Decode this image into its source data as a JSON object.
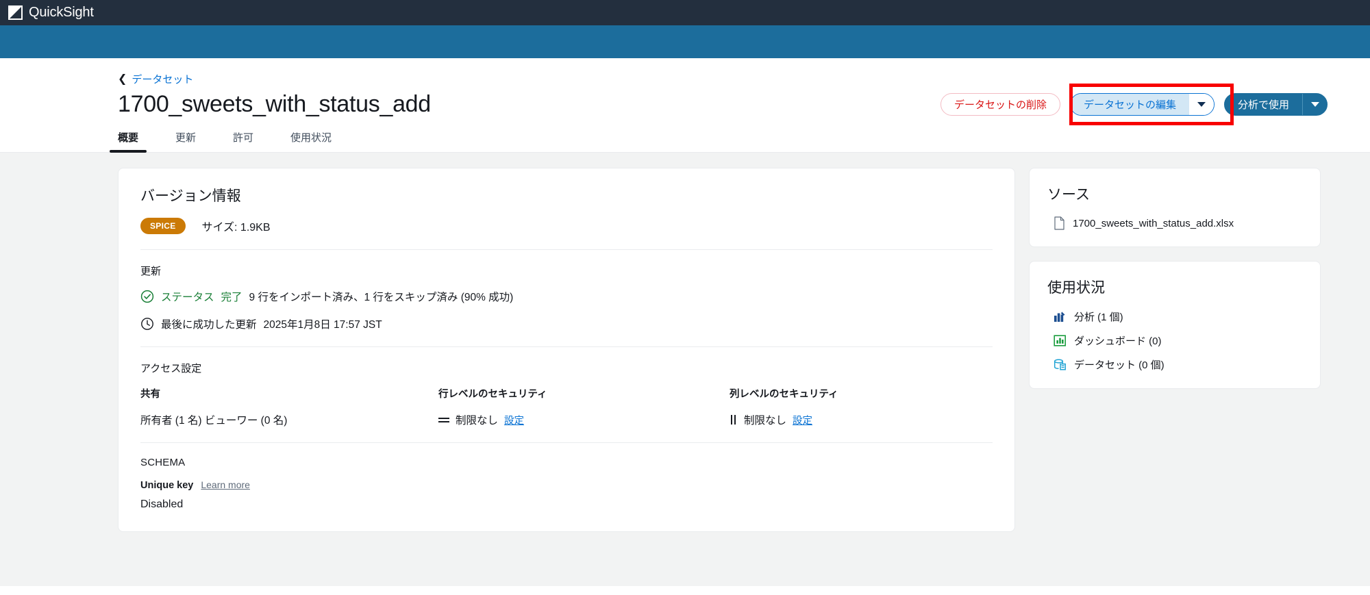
{
  "app": {
    "name": "QuickSight",
    "logo_icon": "quicksight-logo-icon"
  },
  "breadcrumb": {
    "back_icon": "chevron-left-icon",
    "label": "データセット"
  },
  "header": {
    "title": "1700_sweets_with_status_add",
    "actions": {
      "delete_label": "データセットの削除",
      "edit_label": "データセットの編集",
      "edit_dropdown_icon": "chevron-down-icon",
      "use_in_analysis_label": "分析で使用",
      "use_dropdown_icon": "chevron-down-icon",
      "highlight_color": "#f80000"
    }
  },
  "tabs": [
    {
      "label": "概要",
      "active": true
    },
    {
      "label": "更新",
      "active": false
    },
    {
      "label": "許可",
      "active": false
    },
    {
      "label": "使用状況",
      "active": false
    }
  ],
  "version_info": {
    "title": "バージョン情報",
    "badge": "SPICE",
    "badge_color": "#cb7a06",
    "size": "サイズ: 1.9KB"
  },
  "refresh": {
    "title": "更新",
    "status_icon": "check-circle-icon",
    "status_label": "ステータス",
    "status_value": "完了",
    "status_color": "#1a7f37",
    "status_detail": "9 行をインポート済み、1 行をスキップ済み (90% 成功)",
    "clock_icon": "clock-icon",
    "last_success_label": "最後に成功した更新",
    "last_success_value": "2025年1月8日 17:57 JST"
  },
  "access": {
    "title": "アクセス設定",
    "sharing": {
      "header": "共有",
      "value": "所有者 (1 名)  ビューワー (0 名)"
    },
    "row_level": {
      "header": "行レベルのセキュリティ",
      "icon": "rows-icon",
      "value": "制限なし",
      "link": "設定"
    },
    "column_level": {
      "header": "列レベルのセキュリティ",
      "icon": "columns-icon",
      "value": "制限なし",
      "link": "設定"
    }
  },
  "schema": {
    "title": "SCHEMA",
    "unique_key_label": "Unique key",
    "learn_more": "Learn more",
    "unique_key_value": "Disabled"
  },
  "source": {
    "title": "ソース",
    "file_icon": "file-icon",
    "file_name": "1700_sweets_with_status_add.xlsx"
  },
  "usage": {
    "title": "使用状況",
    "items": [
      {
        "icon": "analysis-icon",
        "label": "分析 (1 個)",
        "color": "#1d4f91"
      },
      {
        "icon": "dashboard-icon",
        "label": "ダッシュボード (0)",
        "color": "#1a9c3e"
      },
      {
        "icon": "dataset-icon",
        "label": "データセット (0 個)",
        "color": "#1fa3d4"
      }
    ]
  }
}
